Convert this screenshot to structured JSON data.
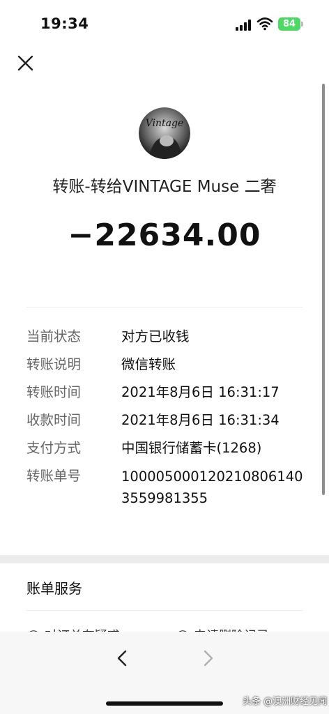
{
  "status_bar": {
    "time": "19:34",
    "battery": "84"
  },
  "header": {
    "close_icon": "close-icon"
  },
  "payee": {
    "avatar_text": "Vintage",
    "title": "转账-转给VINTAGE Muse 二奢",
    "amount": "−22634.00"
  },
  "details": [
    {
      "label": "当前状态",
      "value": "对方已收钱"
    },
    {
      "label": "转账说明",
      "value": "微信转账"
    },
    {
      "label": "转账时间",
      "value": "2021年8月6日 16:31:17"
    },
    {
      "label": "收款时间",
      "value": "2021年8月6日 16:31:34"
    },
    {
      "label": "支付方式",
      "value": "中国银行储蓄卡(1268)"
    },
    {
      "label": "转账单号",
      "value_line1": "10000500012021080614​0",
      "value_line2": "3559981355"
    }
  ],
  "bill_service": {
    "title": "账单服务",
    "item1": "对订单有疑惑",
    "item2": "申请删除记录"
  },
  "bottom_nav": {
    "back_icon": "chevron-left-icon",
    "forward_icon": "chevron-right-icon"
  },
  "watermark": "头条 @澳洲财经见闻",
  "colors": {
    "battery": "#4cd964",
    "background": "#ffffff",
    "band": "#ececec"
  }
}
